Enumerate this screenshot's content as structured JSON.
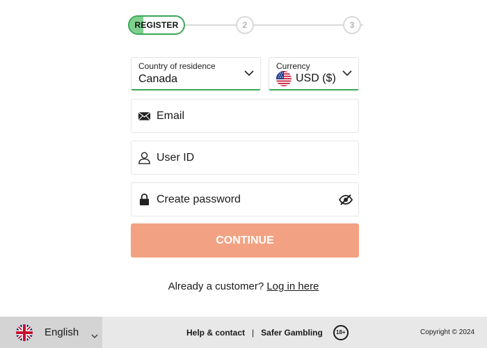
{
  "stepper": {
    "step1_label": "REGISTER",
    "step2_label": "2",
    "step3_label": "3",
    "active_color": "#3aa655"
  },
  "form": {
    "country": {
      "label": "Country of residence",
      "value": "Canada"
    },
    "currency": {
      "label": "Currency",
      "value": "USD ($)"
    },
    "email": {
      "placeholder": "Email",
      "icon": "envelope-icon"
    },
    "user_id": {
      "placeholder": "User ID",
      "icon": "user-icon"
    },
    "password": {
      "placeholder": "Create password",
      "icon": "lock-icon",
      "toggle_icon": "eye-off-icon"
    },
    "continue_label": "CONTINUE",
    "continue_color": "#f2a282"
  },
  "login": {
    "prompt": "Already a customer?",
    "link": "Log in here"
  },
  "footer": {
    "language": "English",
    "help_link": "Help & contact",
    "separator": "|",
    "safer_link": "Safer Gambling",
    "age_badge": "18+",
    "copyright": "Copyright © 2024"
  }
}
